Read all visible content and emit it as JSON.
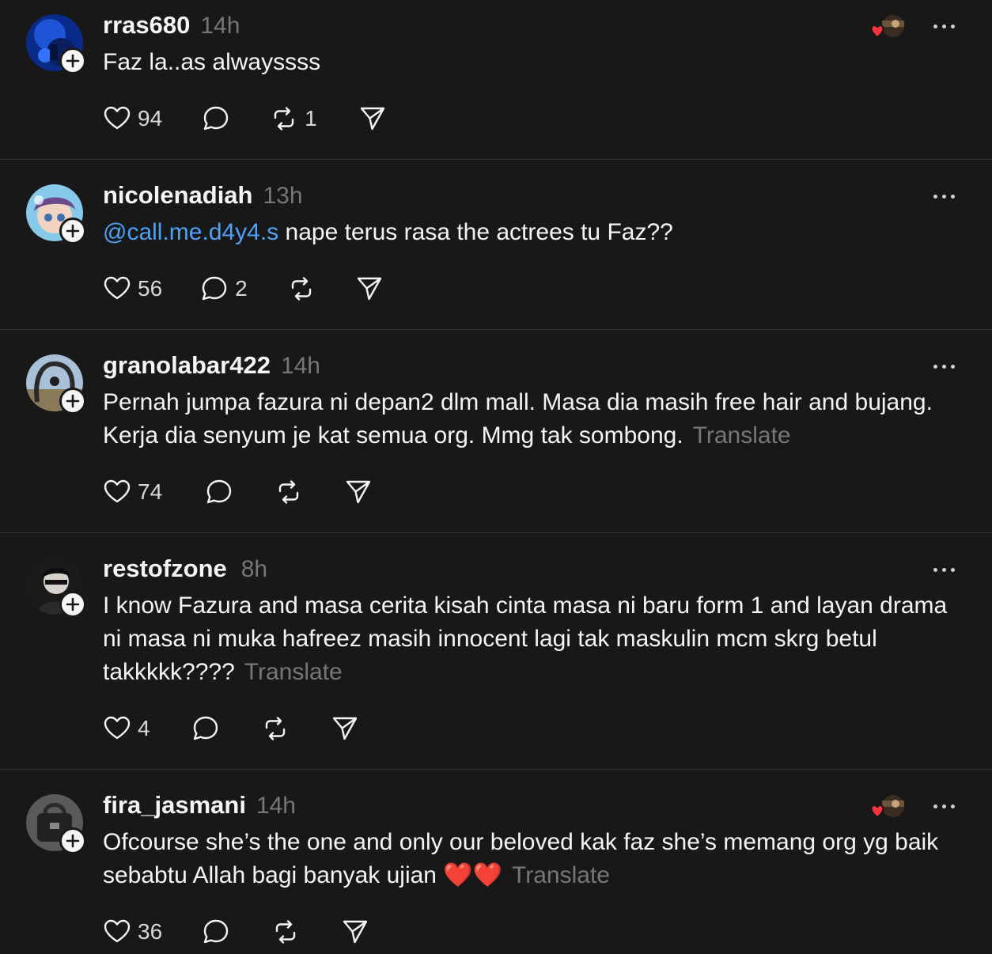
{
  "posts": [
    {
      "username": "rras680",
      "time": "14h",
      "text": "Faz la..as alwayssss",
      "likes": "94",
      "replies": "",
      "reposts": "1"
    },
    {
      "username": "nicolenadiah",
      "time": "13h",
      "mention": "@call.me.d4y4.s",
      "text": " nape terus rasa the actrees tu Faz??",
      "likes": "56",
      "replies": "2",
      "reposts": ""
    },
    {
      "username": "granolabar422",
      "time": "14h",
      "line1": "Pernah jumpa fazura ni depan2 dlm mall. Masa dia masih free hair and bujang.",
      "line2": "Kerja dia senyum je kat semua org. Mmg tak sombong.",
      "translate": "Translate",
      "likes": "74",
      "replies": "",
      "reposts": ""
    },
    {
      "username": "restofzone",
      "time": "8h",
      "line1": "I know Fazura and masa cerita kisah cinta masa ni baru form 1 and layan drama",
      "line2": "ni masa ni muka hafreez masih innocent lagi tak maskulin mcm skrg betul",
      "line3": "takkkkk????",
      "translate": "Translate",
      "likes": "4",
      "replies": "",
      "reposts": ""
    },
    {
      "username": "fira_jasmani",
      "time": "14h",
      "line1": "Ofcourse she’s the one and only our beloved kak faz she’s memang org yg baik",
      "line2": "sebabtu Allah bagi banyak ujian ❤️❤️",
      "translate": "Translate",
      "likes": "36",
      "replies": "",
      "reposts": ""
    }
  ],
  "colors": {
    "background": "#181818",
    "text": "#f3f5f7",
    "muted": "#777777",
    "mention": "#4ea1f5",
    "divider": "#333638",
    "heart": "#ff3040"
  }
}
